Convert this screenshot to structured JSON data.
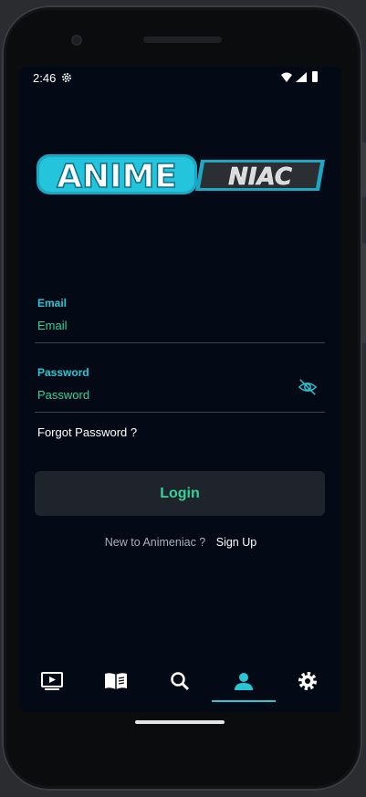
{
  "status_bar": {
    "time": "2:46"
  },
  "logo": {
    "part1": "ANIME",
    "part2": "NIAC"
  },
  "email_field": {
    "label": "Email",
    "placeholder": "Email"
  },
  "password_field": {
    "label": "Password",
    "placeholder": "Password"
  },
  "forgot_password": "Forgot Password ?",
  "login_button": "Login",
  "signup": {
    "prompt": "New to Animeniac ?",
    "link": "Sign Up"
  },
  "bottom_nav": {
    "items": [
      {
        "icon": "play-screen-icon"
      },
      {
        "icon": "book-icon"
      },
      {
        "icon": "search-icon"
      },
      {
        "icon": "person-icon",
        "active": true
      },
      {
        "icon": "gear-icon"
      }
    ]
  },
  "colors": {
    "accent_cyan": "#2ac6d4",
    "accent_green": "#33d39a",
    "background": "#040a15"
  }
}
